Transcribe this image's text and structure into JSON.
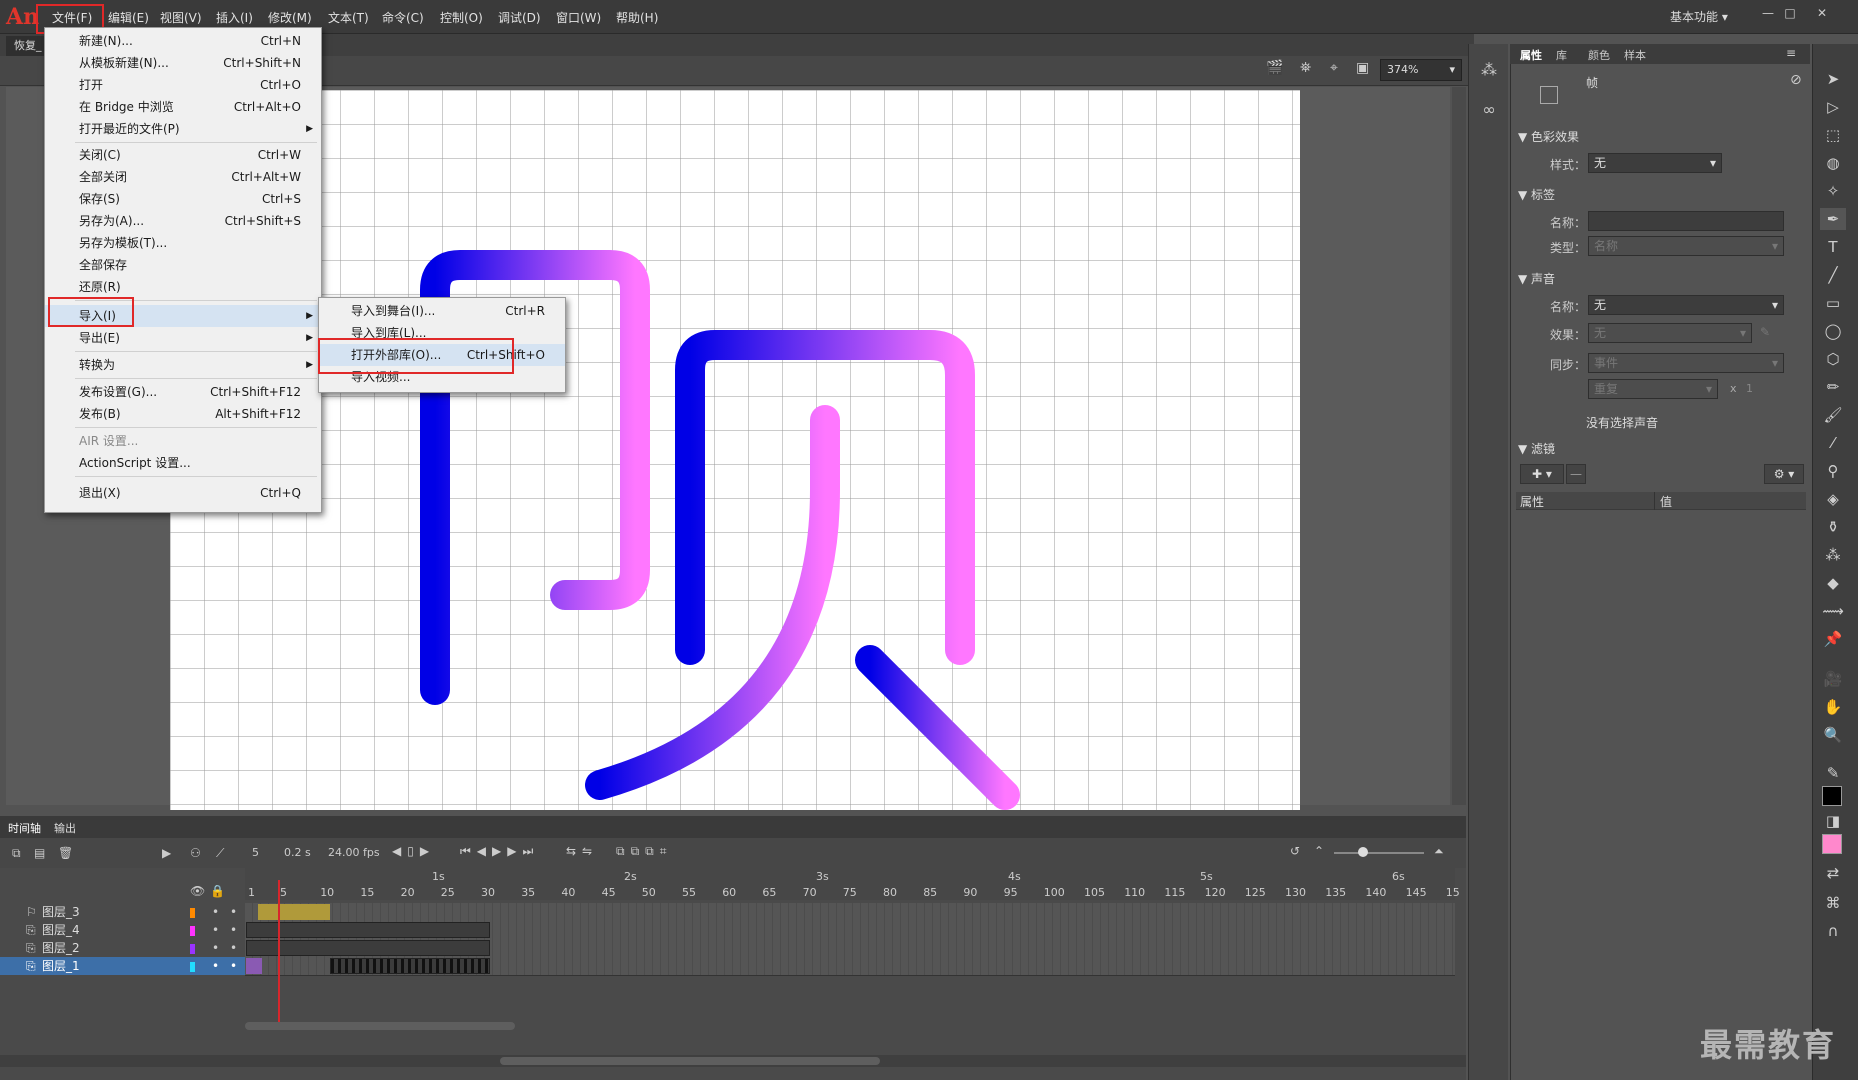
{
  "app": {
    "logo": "An"
  },
  "menubar": {
    "items": [
      "文件(F)",
      "编辑(E)",
      "视图(V)",
      "插入(I)",
      "修改(M)",
      "文本(T)",
      "命令(C)",
      "控制(O)",
      "调试(D)",
      "窗口(W)",
      "帮助(H)"
    ],
    "workspace": "基本功能"
  },
  "doc": {
    "tab": "恢复_",
    "zoom": "374%"
  },
  "file_menu": {
    "items": [
      {
        "label": "新建(N)...",
        "shortcut": "Ctrl+N"
      },
      {
        "label": "从模板新建(N)...",
        "shortcut": "Ctrl+Shift+N"
      },
      {
        "label": "打开",
        "shortcut": "Ctrl+O"
      },
      {
        "label": "在 Bridge 中浏览",
        "shortcut": "Ctrl+Alt+O"
      },
      {
        "label": "打开最近的文件(P)",
        "shortcut": ""
      },
      {
        "label": "关闭(C)",
        "shortcut": "Ctrl+W"
      },
      {
        "label": "全部关闭",
        "shortcut": "Ctrl+Alt+W"
      },
      {
        "label": "保存(S)",
        "shortcut": "Ctrl+S"
      },
      {
        "label": "另存为(A)...",
        "shortcut": "Ctrl+Shift+S"
      },
      {
        "label": "另存为模板(T)...",
        "shortcut": ""
      },
      {
        "label": "全部保存",
        "shortcut": ""
      },
      {
        "label": "还原(R)",
        "shortcut": ""
      },
      {
        "label": "导入(I)",
        "shortcut": ""
      },
      {
        "label": "导出(E)",
        "shortcut": ""
      },
      {
        "label": "转换为",
        "shortcut": ""
      },
      {
        "label": "发布设置(G)...",
        "shortcut": "Ctrl+Shift+F12"
      },
      {
        "label": "发布(B)",
        "shortcut": "Alt+Shift+F12"
      },
      {
        "label": "AIR 设置...",
        "shortcut": ""
      },
      {
        "label": "ActionScript 设置...",
        "shortcut": ""
      },
      {
        "label": "退出(X)",
        "shortcut": "Ctrl+Q"
      }
    ]
  },
  "import_menu": {
    "items": [
      {
        "label": "导入到舞台(I)...",
        "shortcut": "Ctrl+R"
      },
      {
        "label": "导入到库(L)...",
        "shortcut": ""
      },
      {
        "label": "打开外部库(O)...",
        "shortcut": "Ctrl+Shift+O"
      },
      {
        "label": "导入视频...",
        "shortcut": ""
      }
    ]
  },
  "properties": {
    "tabs": [
      "属性",
      "库",
      "颜色",
      "样本"
    ],
    "frame_label": "帧",
    "color_effect": {
      "title": "色彩效果",
      "style_label": "样式：",
      "style_value": "无"
    },
    "label_section": {
      "title": "标签",
      "name_label": "名称：",
      "name_value": "",
      "type_label": "类型：",
      "type_value": "名称"
    },
    "sound": {
      "title": "声音",
      "name_label": "名称：",
      "name_value": "无",
      "effect_label": "效果：",
      "effect_value": "无",
      "sync_label": "同步：",
      "sync_value": "事件",
      "repeat_value": "重复",
      "repeat_x": "x",
      "repeat_count": "1",
      "no_sound": "没有选择声音"
    },
    "filters": {
      "title": "滤镜",
      "col_property": "属性",
      "col_value": "值"
    }
  },
  "timeline": {
    "tabs": [
      "时间轴",
      "输出"
    ],
    "frame": "5",
    "time": "0.2 s",
    "fps": "24.00 fps",
    "ruler_numbers": [
      "1",
      "5",
      "10",
      "15",
      "20",
      "25",
      "30",
      "35",
      "40",
      "45",
      "50",
      "55",
      "60",
      "65",
      "70",
      "75",
      "80",
      "85",
      "90",
      "95",
      "100",
      "105",
      "110",
      "115",
      "120",
      "125",
      "130",
      "135",
      "140",
      "145",
      "15"
    ],
    "seconds": [
      "1s",
      "2s",
      "3s",
      "4s",
      "5s",
      "6s"
    ],
    "layers": [
      {
        "name": "图层_3",
        "color": "#ff8a00"
      },
      {
        "name": "图层_4",
        "color": "#ff33ff"
      },
      {
        "name": "图层_2",
        "color": "#9933ff"
      },
      {
        "name": "图层_1",
        "color": "#22ddff"
      }
    ]
  },
  "watermark": "最需教育"
}
